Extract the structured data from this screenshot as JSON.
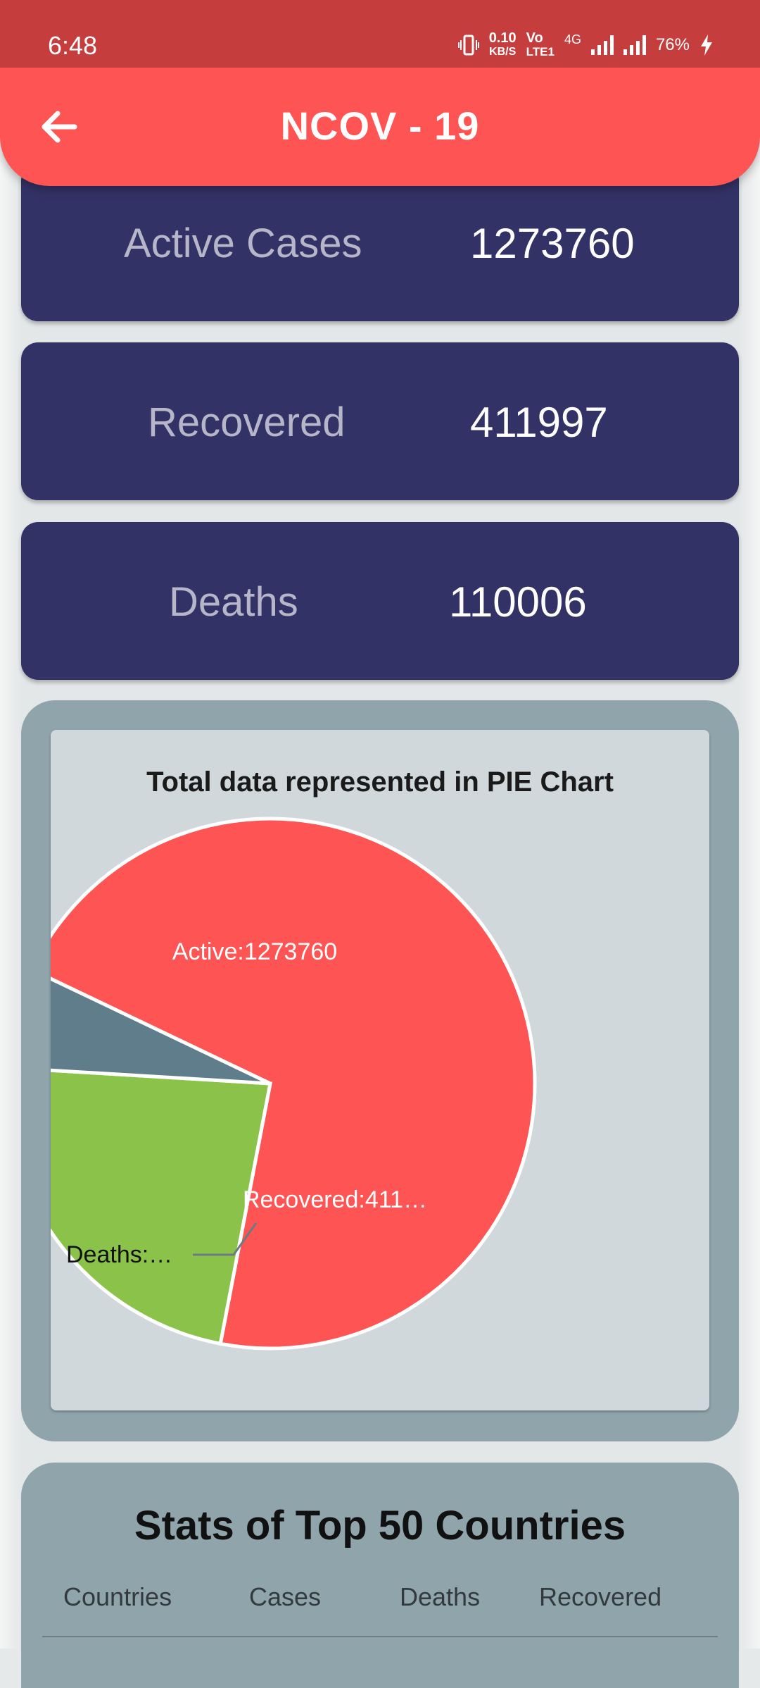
{
  "status": {
    "time": "6:48",
    "net_speed_value": "0.10",
    "net_speed_unit": "KB/S",
    "volte_top": "Vo",
    "volte_bottom": "LTE1",
    "network": "4G",
    "battery": "76%"
  },
  "appbar": {
    "title": "NCOV - 19"
  },
  "cards": {
    "active_label": "Active Cases",
    "active_value": "1273760",
    "recovered_label": "Recovered",
    "recovered_value": "411997",
    "deaths_label": "Deaths",
    "deaths_value": "110006"
  },
  "pie": {
    "title": "Total data represented in PIE Chart"
  },
  "chart_data": {
    "type": "pie",
    "title": "Total data represented in PIE Chart",
    "slices": [
      {
        "name": "Active",
        "value": 1273760,
        "label": "Active:1273760",
        "color": "#fe5554"
      },
      {
        "name": "Recovered",
        "value": 411997,
        "label": "Recovered:411…",
        "color": "#8bc34a"
      },
      {
        "name": "Deaths",
        "value": 110006,
        "label": "Deaths:…",
        "color": "#607d8b"
      }
    ]
  },
  "stats": {
    "title": "Stats of Top 50 Countries",
    "headers": [
      "Countries",
      "Cases",
      "Deaths",
      "Recovered"
    ]
  }
}
